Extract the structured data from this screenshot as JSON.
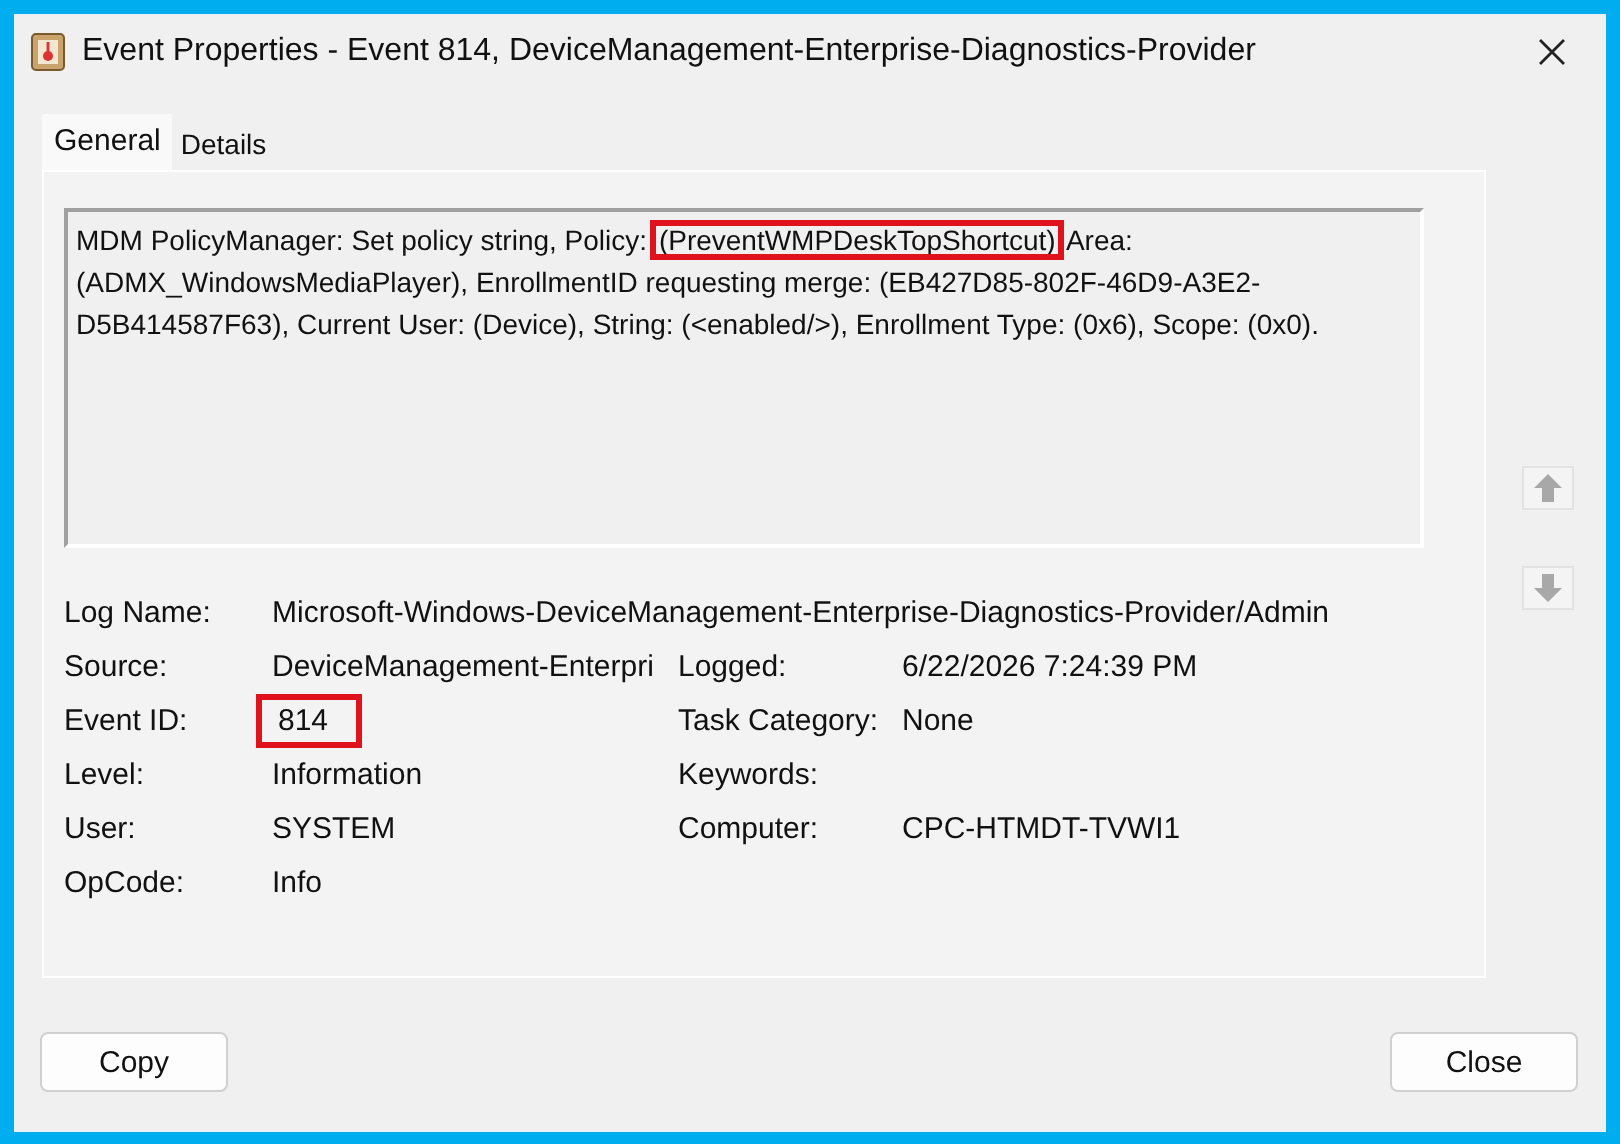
{
  "window": {
    "title": "Event Properties - Event 814, DeviceManagement-Enterprise-Diagnostics-Provider"
  },
  "tabs": [
    {
      "label": "General",
      "selected": true
    },
    {
      "label": "Details",
      "selected": false
    }
  ],
  "message_parts": [
    {
      "text": "MDM PolicyManager: Set policy string, Policy: ",
      "highlighted": false
    },
    {
      "text": "(PreventWMPDeskTopShortcut)",
      "highlighted": true
    },
    {
      "text": " Area: (ADMX_WindowsMediaPlayer), EnrollmentID requesting merge: (EB427D85-802F-46D9-A3E2-D5B414587F63), Current User: (Device), String: (<enabled/>), Enrollment Type: (0x6), Scope: (0x0).",
      "highlighted": false
    }
  ],
  "detail_rows": [
    {
      "cells": [
        {
          "label": "Log Name:",
          "value": "Microsoft-Windows-DeviceManagement-Enterprise-Diagnostics-Provider/Admin",
          "highlighted": false
        }
      ]
    },
    {
      "cells": [
        {
          "label": "Source:",
          "value": "DeviceManagement-Enterpri",
          "highlighted": false
        },
        {
          "label": "Logged:",
          "value": "6/22/2026 7:24:39 PM",
          "highlighted": false
        }
      ]
    },
    {
      "cells": [
        {
          "label": "Event ID:",
          "value": "814",
          "highlighted": true
        },
        {
          "label": "Task Category:",
          "value": "None",
          "highlighted": false
        }
      ]
    },
    {
      "cells": [
        {
          "label": "Level:",
          "value": "Information",
          "highlighted": false
        },
        {
          "label": "Keywords:"
        }
      ]
    },
    {
      "cells": [
        {
          "label": "User:",
          "value": "SYSTEM",
          "highlighted": false
        },
        {
          "label": "Computer:",
          "value": "CPC-HTMDT-TVWI1",
          "highlighted": false
        }
      ]
    },
    {
      "cells": [
        {
          "label": "OpCode:",
          "value": "Info",
          "highlighted": false
        }
      ]
    }
  ],
  "buttons": [
    "Copy",
    "Close"
  ]
}
